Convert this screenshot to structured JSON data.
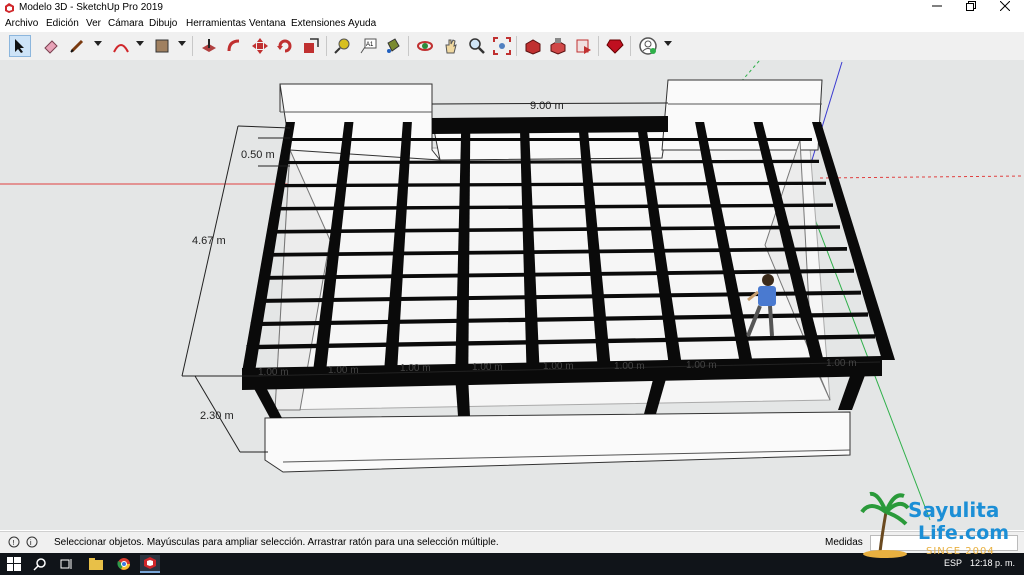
{
  "window": {
    "title": "Modelo 3D - SketchUp Pro 2019",
    "minimize_icon": "minimize-icon",
    "maximize_icon": "restore-icon",
    "close_icon": "close-icon"
  },
  "menu": [
    {
      "label": "Archivo"
    },
    {
      "label": "Edición"
    },
    {
      "label": "Ver"
    },
    {
      "label": "Cámara"
    },
    {
      "label": "Dibujo"
    },
    {
      "label": "Herramientas"
    },
    {
      "label": "Ventana"
    },
    {
      "label": "Extensiones"
    },
    {
      "label": "Ayuda"
    }
  ],
  "toolbar": {
    "tools": [
      "select-icon",
      "eraser-icon",
      "pencil-icon",
      "arc-icon",
      "rectangle-icon",
      "push-pull-icon",
      "follow-me-icon",
      "move-icon",
      "rotate-icon",
      "scale-icon",
      "tape-measure-icon",
      "text-icon",
      "paint-bucket-icon",
      "orbit-icon",
      "pan-icon",
      "zoom-icon",
      "zoom-extents-icon",
      "3d-warehouse-icon",
      "extension-warehouse-icon",
      "layout-icon",
      "ruby-console-icon",
      "account-icon"
    ]
  },
  "model": {
    "dimensions": {
      "width": "9.00 m",
      "depth": "4.67 m",
      "offset": "0.50 m",
      "height": "2.30 m",
      "spacing": [
        "1.00 m",
        "1.00 m",
        "1.00 m",
        "1.00 m",
        "1.00 m",
        "1.00 m",
        "1.00 m",
        "1.00 m"
      ]
    }
  },
  "status": {
    "info_icon": "info-icon",
    "help_icon": "help-icon",
    "message": "Seleccionar objetos. Mayúsculas para ampliar selección. Arrastrar ratón para una selección múltiple.",
    "measure_label": "Medidas"
  },
  "taskbar": {
    "items": [
      "windows-start-icon",
      "search-icon",
      "task-view-icon",
      "file-explorer-icon",
      "chrome-icon",
      "sketchup-icon"
    ],
    "language": "ESP",
    "time": "12:18 p. m."
  },
  "watermark": {
    "line1": "Sayulita",
    "line2": "Life.com",
    "line3": "SINCE 2004"
  },
  "colors": {
    "viewport_bg": "#e4e6e6",
    "beam": "#0a0a0a",
    "axis_red": "#e04040",
    "axis_green": "#2fb04a",
    "axis_blue": "#3a3ad0",
    "watermark_blue": "#1c8fd6"
  }
}
